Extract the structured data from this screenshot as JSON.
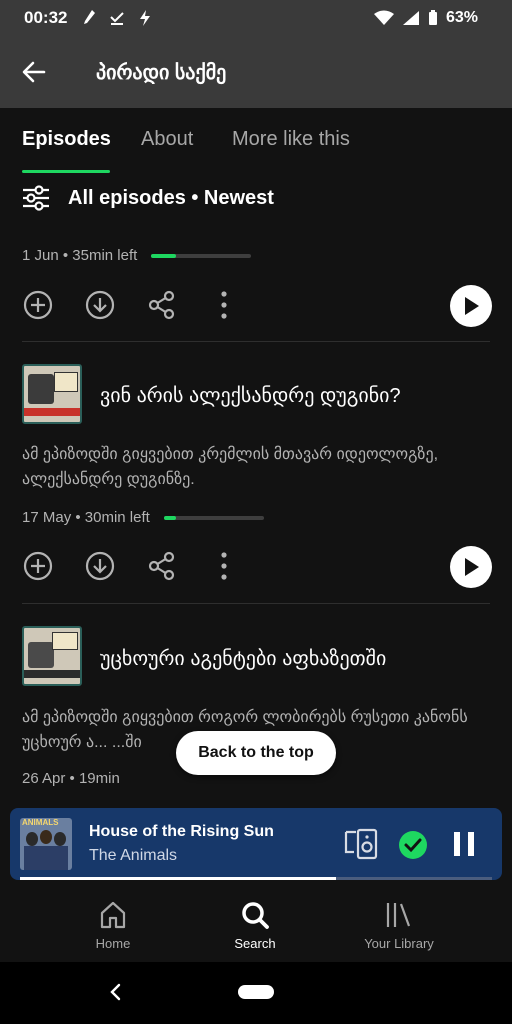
{
  "status_bar": {
    "time": "00:32",
    "battery": "63%"
  },
  "header": {
    "title": "პირადი საქმე"
  },
  "tabs": [
    {
      "label": "Episodes"
    },
    {
      "label": "About"
    },
    {
      "label": "More like this"
    }
  ],
  "filter": {
    "label": "All episodes • Newest"
  },
  "episodes": [
    {
      "meta": "1 Jun • 35min left",
      "progress": 0.25
    },
    {
      "title": "ვინ არის ალექსანდრე დუგინი?",
      "description": "ამ ეპიზოდში გიყვებით კრემლის მთავარ იდეოლოგზე, ალექსანდრე დუგინზე.",
      "meta": "17 May • 30min left",
      "progress": 0.12
    },
    {
      "title": "უცხოური აგენტები აფხაზეთში",
      "description": "ამ ეპიზოდში გიყვებით როგორ ლობირებს რუსეთი კანონს უცხოურ ა... ...ში",
      "meta": "26 Apr • 19min"
    }
  ],
  "back_to_top": {
    "label": "Back to the top"
  },
  "now_playing": {
    "title": "House of the Rising Sun",
    "artist": "The Animals",
    "art_text": "ANIMALS",
    "progress": 0.67
  },
  "nav": [
    {
      "label": "Home"
    },
    {
      "label": "Search"
    },
    {
      "label": "Your Library"
    }
  ],
  "colors": {
    "accent": "#1ed760",
    "background": "#121212",
    "header_bg": "#3a3a3a",
    "player_bg": "#17386a"
  },
  "icons": [
    "arrow-back-icon",
    "filter-icon",
    "add-icon",
    "download-icon",
    "share-icon",
    "more-icon",
    "play-icon",
    "devices-icon",
    "check-icon",
    "pause-icon",
    "home-icon",
    "search-icon",
    "library-icon"
  ]
}
